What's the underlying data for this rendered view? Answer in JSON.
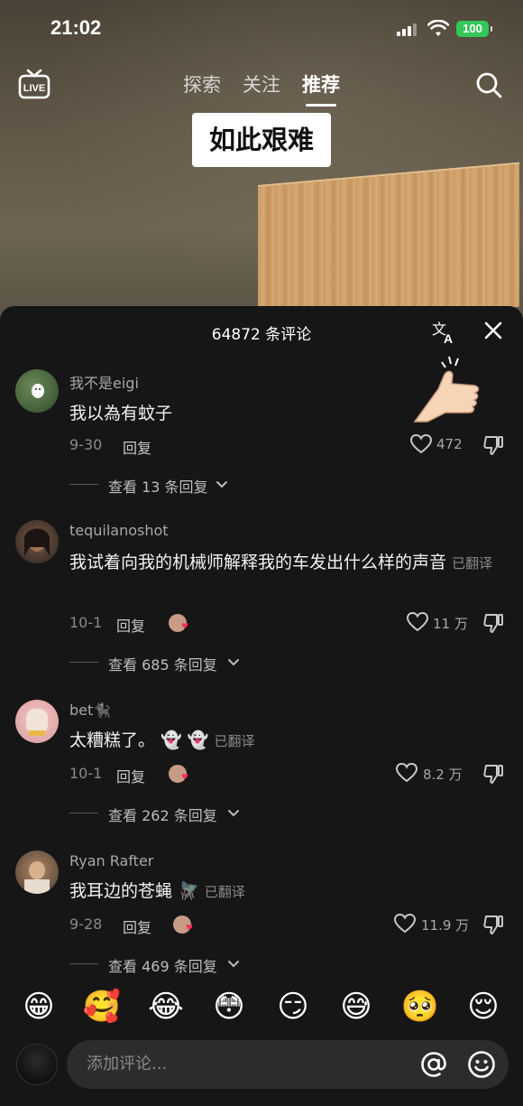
{
  "status_bar": {
    "time": "21:02",
    "battery": "100"
  },
  "nav": {
    "tabs": [
      {
        "label": "探索",
        "active": false
      },
      {
        "label": "关注",
        "active": false
      },
      {
        "label": "推荐",
        "active": true
      }
    ],
    "live_icon": "live-tv-icon",
    "search_icon": "search-icon"
  },
  "video": {
    "caption": "如此艰难"
  },
  "comments_header": {
    "count_label": "64872 条评论"
  },
  "comments": [
    {
      "username": "我不是eigi",
      "text": "我以為有蚊子",
      "translated": "",
      "date": "9-30",
      "reply_label": "回复",
      "likes": "472",
      "view_replies": "查看 13 条回复"
    },
    {
      "username": "tequilanoshot",
      "text": "我试着向我的机械师解释我的车发出什么样的声音",
      "translated": "已翻译",
      "date": "10-1",
      "reply_label": "回复",
      "likes": "11 万",
      "view_replies": "查看 685 条回复"
    },
    {
      "username": "bet🐈‍⬛",
      "text": "太糟糕了。 👻 👻",
      "translated": "已翻译",
      "date": "10-1",
      "reply_label": "回复",
      "likes": "8.2 万",
      "view_replies": "查看 262 条回复"
    },
    {
      "username": "Ryan Rafter",
      "text": "我耳边的苍蝇 🪰",
      "translated": "已翻译",
      "date": "9-28",
      "reply_label": "回复",
      "likes": "11.9 万",
      "view_replies": "查看 469 条回复"
    }
  ],
  "emoji_bar": [
    "😁",
    "🥰",
    "😂",
    "😳",
    "😏",
    "😅",
    "🥺",
    "😌"
  ],
  "input": {
    "placeholder": "添加评论..."
  },
  "colors": {
    "sheet_bg": "#161616",
    "input_bg": "#2c2c2c",
    "battery": "#34c759",
    "heart_badge": "#ff2d55"
  }
}
